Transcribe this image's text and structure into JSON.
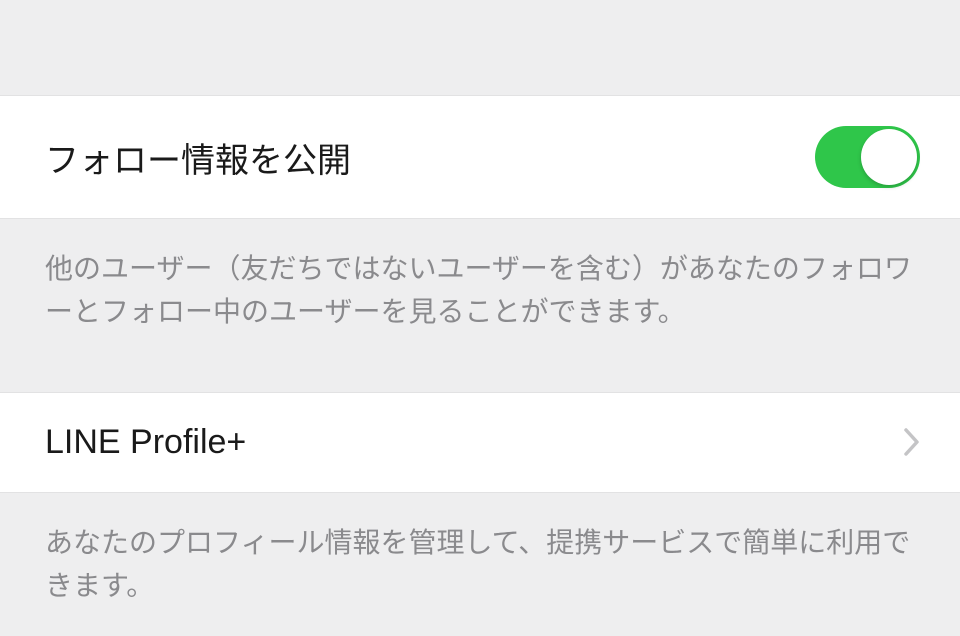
{
  "settings": {
    "follow_info_public": {
      "label": "フォロー情報を公開",
      "enabled": true,
      "description": "他のユーザー（友だちではないユーザーを含む）があなたのフォロワーとフォロー中のユーザーを見ることができます。"
    },
    "line_profile_plus": {
      "label": "LINE Profile+",
      "description": "あなたのプロフィール情報を管理して、提携サービスで簡単に利用できます。"
    }
  }
}
